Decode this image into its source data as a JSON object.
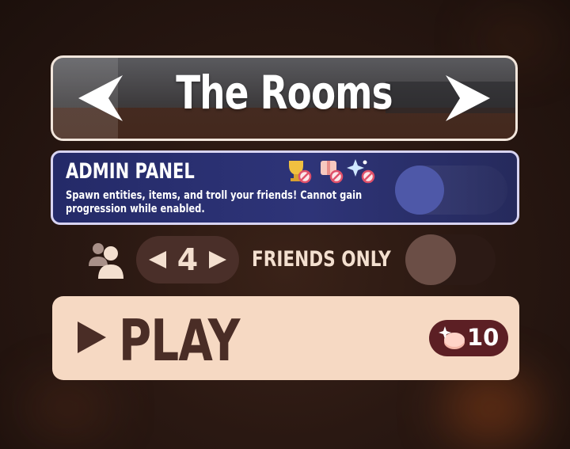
{
  "map_selector": {
    "title": "The Rooms",
    "prev_icon": "arrow-left-icon",
    "next_icon": "arrow-right-icon"
  },
  "admin_panel": {
    "title": "ADMIN PANEL",
    "description": "Spawn entities, items, and troll your friends! Cannot gain progression while enabled.",
    "icons": [
      "trophy-disabled-icon",
      "gift-disabled-icon",
      "sparkle-disabled-icon"
    ],
    "enabled": false,
    "accent_color": "#2a3070"
  },
  "lobby": {
    "players_icon": "people-icon",
    "player_count": "4",
    "friends_only_label": "FRIENDS ONLY",
    "friends_only_enabled": false
  },
  "play": {
    "label": "PLAY",
    "cost": "10",
    "cost_icon": "coin-sparkle-icon",
    "button_color": "#f6d9c3",
    "cost_color": "#5c1f24"
  }
}
